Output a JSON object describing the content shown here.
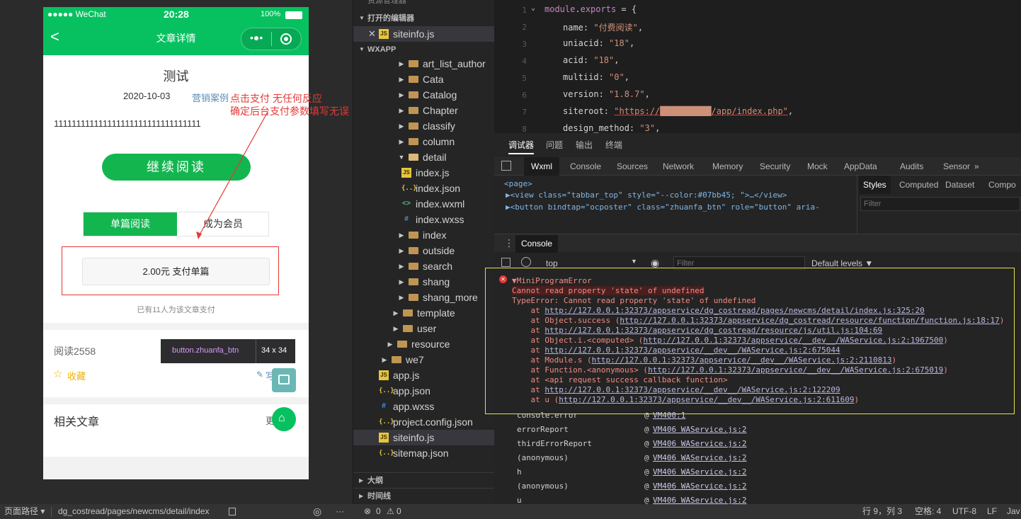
{
  "phone": {
    "status": {
      "carrier": "●●●●● WeChat",
      "time": "20:28",
      "battery": "100%"
    },
    "nav_title": "文章详情",
    "article_title": "测试",
    "date": "2020-10-03",
    "tag": "营销案例",
    "body_text": "111111111111111111111111111111111",
    "continue_btn": "继续阅读",
    "tab_single": "单篇阅读",
    "tab_member": "成为会员",
    "pay_btn": "2.00元 支付单篇",
    "paid_count": "已有11人为该文章支付",
    "read_count": "阅读2558",
    "fav": "收藏",
    "related": "相关文章",
    "related_more": "更",
    "write": "写",
    "tooltip_name": "button.zhuanfa_btn",
    "tooltip_size": "34 x 34"
  },
  "annotation": {
    "line1": "点击支付  无任何反应",
    "line2": "确定后台支付参数填写无误"
  },
  "explorer": {
    "title": "资源管理器",
    "open_editors": "打开的编辑器",
    "open_file": "siteinfo.js",
    "project": "WXAPP",
    "tree": [
      {
        "label": "art_list_author",
        "kind": "folder"
      },
      {
        "label": "Cata",
        "kind": "folder"
      },
      {
        "label": "Catalog",
        "kind": "folder"
      },
      {
        "label": "Chapter",
        "kind": "folder"
      },
      {
        "label": "classify",
        "kind": "folder"
      },
      {
        "label": "column",
        "kind": "folder"
      },
      {
        "label": "detail",
        "kind": "folder-open"
      },
      {
        "label": "index.js",
        "kind": "js"
      },
      {
        "label": "index.json",
        "kind": "json"
      },
      {
        "label": "index.wxml",
        "kind": "wxml"
      },
      {
        "label": "index.wxss",
        "kind": "wxss"
      },
      {
        "label": "index",
        "kind": "folder"
      },
      {
        "label": "outside",
        "kind": "folder"
      },
      {
        "label": "search",
        "kind": "folder"
      },
      {
        "label": "shang",
        "kind": "folder"
      },
      {
        "label": "shang_more",
        "kind": "folder"
      },
      {
        "label": "template",
        "kind": "folder"
      },
      {
        "label": "user",
        "kind": "folder"
      },
      {
        "label": "resource",
        "kind": "folder"
      },
      {
        "label": "we7",
        "kind": "folder"
      },
      {
        "label": "app.js",
        "kind": "js"
      },
      {
        "label": "app.json",
        "kind": "json"
      },
      {
        "label": "app.wxss",
        "kind": "wxss"
      },
      {
        "label": "project.config.json",
        "kind": "json"
      },
      {
        "label": "siteinfo.js",
        "kind": "js"
      },
      {
        "label": "sitemap.json",
        "kind": "json"
      }
    ],
    "outline": "大纲",
    "timeline": "时间线"
  },
  "editor": {
    "lines": [
      {
        "n": "1",
        "html": "module.exports = {"
      },
      {
        "n": "2",
        "key": "name",
        "val": "\"付费阅读\""
      },
      {
        "n": "3",
        "key": "uniacid",
        "val": "\"18\""
      },
      {
        "n": "4",
        "key": "acid",
        "val": "\"18\""
      },
      {
        "n": "5",
        "key": "multiid",
        "val": "\"0\""
      },
      {
        "n": "6",
        "key": "version",
        "val": "\"1.8.7\""
      },
      {
        "n": "7",
        "key": "siteroot",
        "val": "\"https://██████████/app/index.php\""
      },
      {
        "n": "8",
        "key": "design_method",
        "val": "\"3\""
      }
    ]
  },
  "devtools": {
    "top_tabs": [
      "调试器",
      "问题",
      "输出",
      "终端"
    ],
    "panel_tabs": [
      "Wxml",
      "Console",
      "Sources",
      "Network",
      "Memory",
      "Security",
      "Mock",
      "AppData",
      "Audits",
      "Sensor"
    ],
    "more": "»",
    "wxml_lines": [
      "<page>",
      "▶<view class=\"tabbar_top\" style=\"--color:#07bb45; \">…</view>",
      "▶<button bindtap=\"ocposter\" class=\"zhuanfa_btn\" role=\"button\" aria-"
    ],
    "style_tabs": [
      "Styles",
      "Computed",
      "Dataset",
      "Compo"
    ],
    "filter_placeholder": "Filter",
    "console_tab": "Console",
    "context": "top",
    "console_filter": "Filter",
    "levels": "Default levels ▼",
    "error_title": "▼MiniProgramError",
    "error_msg": "Cannot read property 'state' of undefined",
    "type_error": "TypeError: Cannot read property 'state' of undefined",
    "stack": [
      {
        "pre": "    at ",
        "fn": "",
        "link": "http://127.0.0.1:32373/appservice/dg_costread/pages/newcms/detail/index.js:325:20",
        "post": ""
      },
      {
        "pre": "    at ",
        "fn": "Object.success (",
        "link": "http://127.0.0.1:32373/appservice/dg_costread/resource/function/function.js:18:17",
        "post": ")"
      },
      {
        "pre": "    at ",
        "fn": "",
        "link": "http://127.0.0.1:32373/appservice/dg_costread/resource/js/util.js:104:69",
        "post": ""
      },
      {
        "pre": "    at ",
        "fn": "Object.i.<computed> (",
        "link": "http://127.0.0.1:32373/appservice/__dev__/WAService.js:2:1967500",
        "post": ")"
      },
      {
        "pre": "    at ",
        "fn": "",
        "link": "http://127.0.0.1:32373/appservice/__dev__/WAService.js:2:675044",
        "post": ""
      },
      {
        "pre": "    at ",
        "fn": "Module.s (",
        "link": "http://127.0.0.1:32373/appservice/__dev__/WAService.js:2:2110813",
        "post": ")"
      },
      {
        "pre": "    at ",
        "fn": "Function.<anonymous> (",
        "link": "http://127.0.0.1:32373/appservice/__dev__/WAService.js:2:675019",
        "post": ")"
      },
      {
        "pre": "    at ",
        "fn": "<api request success callback function>",
        "link": "",
        "post": ""
      },
      {
        "pre": "    at ",
        "fn": "",
        "link": "http://127.0.0.1:32373/appservice/__dev__/WAService.js:2:122209",
        "post": ""
      },
      {
        "pre": "    at ",
        "fn": "u (",
        "link": "http://127.0.0.1:32373/appservice/__dev__/WAService.js:2:611609",
        "post": ")"
      }
    ],
    "calls": [
      {
        "name": "console.error",
        "src": "VM400:1"
      },
      {
        "name": "errorReport",
        "src": "VM406 WAService.js:2"
      },
      {
        "name": "thirdErrorReport",
        "src": "VM406 WAService.js:2"
      },
      {
        "name": "(anonymous)",
        "src": "VM406 WAService.js:2"
      },
      {
        "name": "h",
        "src": "VM406 WAService.js:2"
      },
      {
        "name": "(anonymous)",
        "src": "VM406 WAService.js:2"
      },
      {
        "name": "u",
        "src": "VM406 WAService.js:2"
      }
    ]
  },
  "status": {
    "page_path_label": "页面路径 ▾",
    "page_path": "dg_costread/pages/newcms/detail/index",
    "errors": "0",
    "warnings": "0",
    "cursor": "行 9，列 3",
    "spaces": "空格: 4",
    "encoding": "UTF-8",
    "eol": "LF",
    "lang": "Jav"
  },
  "colors": {
    "wechat_green": "#07c160",
    "annotation_red": "#e53935",
    "highlight_yellow": "#e6e04a"
  }
}
